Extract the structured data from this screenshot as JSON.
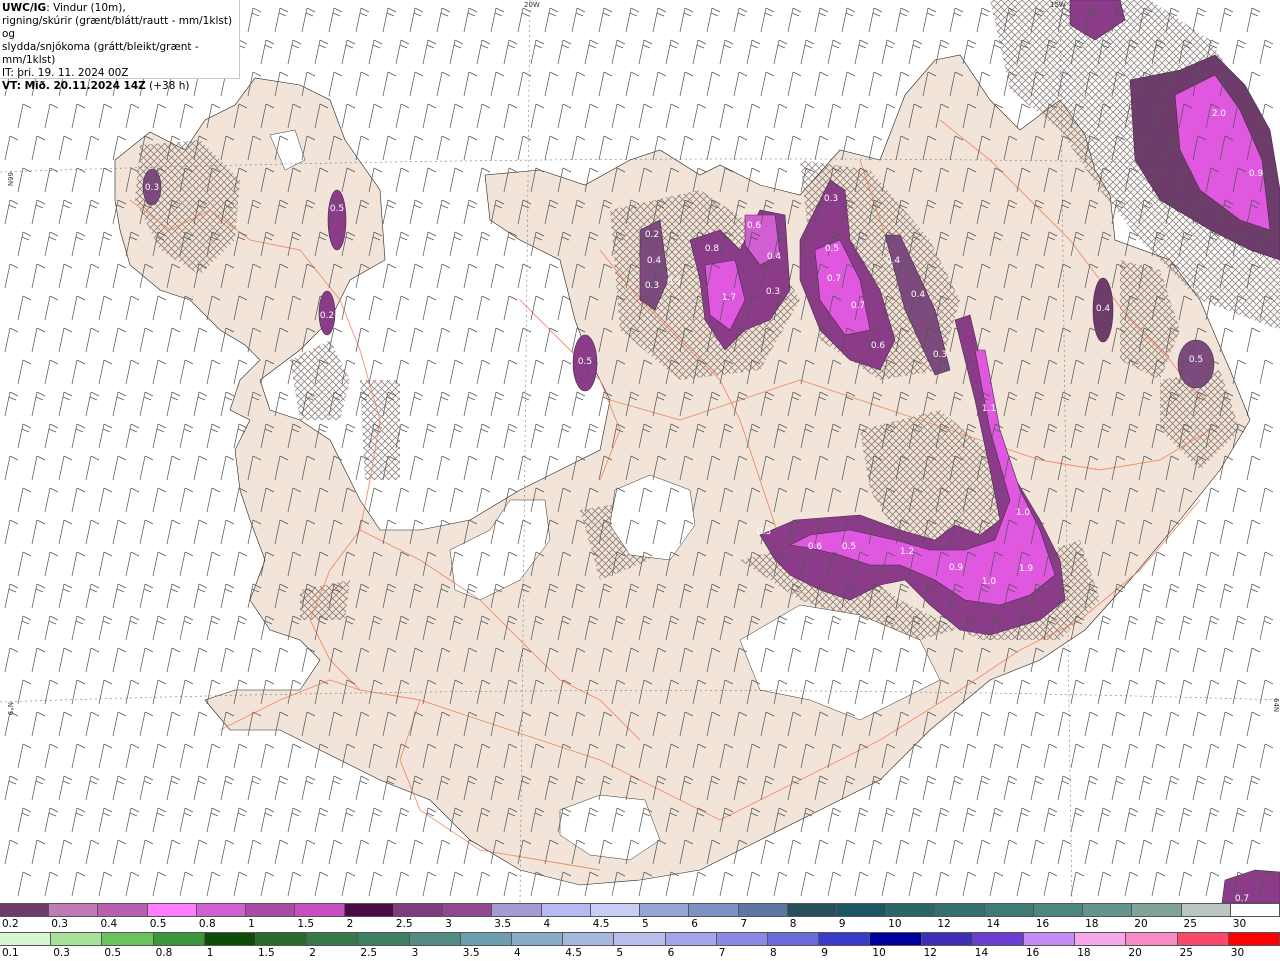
{
  "info": {
    "model": "UWC/IG",
    "desc1": ": Vindur (10m),",
    "desc2": "rigning/skúrir (grænt/blátt/rautt - mm/1klst) og",
    "desc3": "slydda/snjókoma (grátt/bleikt/grænt - mm/1klst)",
    "it": "IT: þri. 19. 11. 2024 00Z",
    "vt": "VT: Mið. 20.11.2024 14Z",
    "lead": " (+38 h)"
  },
  "grid_labels": {
    "lon_20w": "20W",
    "lon_15w": "15W",
    "lat_66n": "66N",
    "lat_64n": "64N"
  },
  "precip_values": [
    {
      "label": "0.3"
    },
    {
      "label": "0.5"
    },
    {
      "label": "0.2"
    },
    {
      "label": "0.2"
    },
    {
      "label": "0.4"
    },
    {
      "label": "0.5"
    },
    {
      "label": "0.3"
    },
    {
      "label": "0.8"
    },
    {
      "label": "1.7"
    },
    {
      "label": "0.6"
    },
    {
      "label": "0.4"
    },
    {
      "label": "0.3"
    },
    {
      "label": "0.5"
    },
    {
      "label": "0.7"
    },
    {
      "label": "0.4"
    },
    {
      "label": "0.4"
    },
    {
      "label": "0.7"
    },
    {
      "label": "0.6"
    },
    {
      "label": "0.3"
    },
    {
      "label": "0.3"
    },
    {
      "label": "0.5"
    },
    {
      "label": "1.1"
    },
    {
      "label": "1.0"
    },
    {
      "label": "0.3"
    },
    {
      "label": "0.6"
    },
    {
      "label": "0.5"
    },
    {
      "label": "1.2"
    },
    {
      "label": "0.9"
    },
    {
      "label": "1.0"
    },
    {
      "label": "1.9"
    },
    {
      "label": "0.4"
    },
    {
      "label": "0.5"
    },
    {
      "label": "2.0"
    },
    {
      "label": "0.9"
    },
    {
      "label": "0.7"
    }
  ],
  "legend_snow": {
    "labels": [
      "0.2",
      "0.3",
      "0.4",
      "0.5",
      "0.8",
      "1",
      "1.5",
      "2",
      "2.5",
      "3",
      "3.5",
      "4",
      "4.5",
      "5",
      "6",
      "7",
      "8",
      "9",
      "10",
      "12",
      "14",
      "16",
      "18",
      "20",
      "25",
      "30"
    ],
    "colors": [
      "#6d3c6a",
      "#c07ab8",
      "#b95fb0",
      "#ff7cff",
      "#d25ed3",
      "#a84ba4",
      "#c64ec0",
      "#4b0a45",
      "#7e3b80",
      "#914891",
      "#a29bd4",
      "#b8b8f2",
      "#c7cdf5",
      "#94a6d8",
      "#7f92c6",
      "#5c77a6",
      "#28505a",
      "#175863",
      "#2a6668",
      "#33706f",
      "#3d7c75",
      "#4d8880",
      "#63958c",
      "#7ea49b",
      "#bcc6c1",
      "#ffffff"
    ]
  },
  "legend_rain": {
    "labels": [
      "0.1",
      "0.3",
      "0.5",
      "0.8",
      "1",
      "1.5",
      "2",
      "2.5",
      "3",
      "3.5",
      "4",
      "4.5",
      "5",
      "6",
      "7",
      "8",
      "9",
      "10",
      "12",
      "14",
      "16",
      "18",
      "20",
      "25",
      "30"
    ],
    "colors": [
      "#d7f7d2",
      "#a7e29d",
      "#6ac45d",
      "#3c963b",
      "#0e4d09",
      "#2b6a2b",
      "#367a4c",
      "#3e8062",
      "#548c83",
      "#6e9eb0",
      "#8cabc9",
      "#a7b8df",
      "#b8bfec",
      "#a2a7ec",
      "#8a8ae4",
      "#6a6ad8",
      "#3a3ac8",
      "#00009f",
      "#3f2fb4",
      "#6a3fd0",
      "#c38ef3",
      "#f6a6ea",
      "#f78bc5",
      "#f74a6a",
      "#ff0000"
    ]
  }
}
